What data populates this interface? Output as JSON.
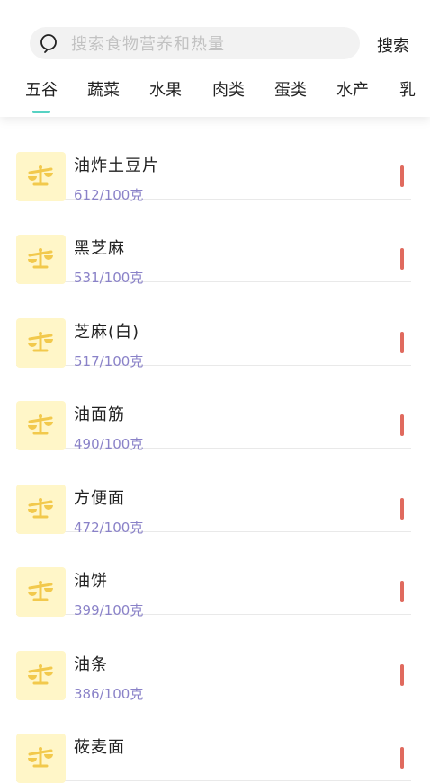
{
  "search": {
    "placeholder": "搜索食物营养和热量",
    "button_label": "搜索"
  },
  "tabs": [
    {
      "label": "五谷",
      "selected": true
    },
    {
      "label": "蔬菜",
      "selected": false
    },
    {
      "label": "水果",
      "selected": false
    },
    {
      "label": "肉类",
      "selected": false
    },
    {
      "label": "蛋类",
      "selected": false
    },
    {
      "label": "水产",
      "selected": false
    },
    {
      "label": "乳",
      "selected": false
    }
  ],
  "colors": {
    "accent": "#56d2c3",
    "calorie_text": "#8a82c8",
    "level_bar": "#e06a5e",
    "icon_bg": "#fff6c8",
    "icon_fg": "#f2c94c"
  },
  "foods": [
    {
      "name": "油炸土豆片",
      "calories": "612/100克",
      "icon": "scale-icon"
    },
    {
      "name": "黑芝麻",
      "calories": "531/100克",
      "icon": "scale-icon"
    },
    {
      "name": "芝麻(白)",
      "calories": "517/100克",
      "icon": "scale-icon"
    },
    {
      "name": "油面筋",
      "calories": "490/100克",
      "icon": "scale-icon"
    },
    {
      "name": "方便面",
      "calories": "472/100克",
      "icon": "scale-icon"
    },
    {
      "name": "油饼",
      "calories": "399/100克",
      "icon": "scale-icon"
    },
    {
      "name": "油条",
      "calories": "386/100克",
      "icon": "scale-icon"
    },
    {
      "name": "莜麦面",
      "calories": "",
      "icon": "scale-icon"
    }
  ]
}
